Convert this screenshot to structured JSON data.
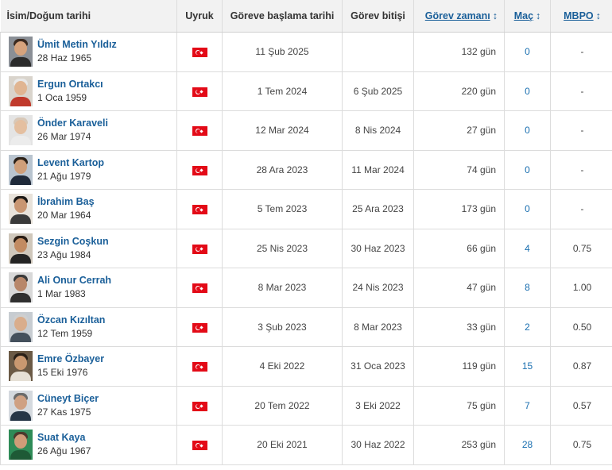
{
  "table": {
    "headers": {
      "name": "İsim/Doğum tarihi",
      "nationality": "Uyruk",
      "start": "Göreve başlama tarihi",
      "end": "Görev bitişi",
      "duration": "Görev zamanı",
      "matches": "Maç",
      "mbpo": "MBPO"
    },
    "sort_icon": "sort-icon",
    "flag_icon": "turkey-flag-icon",
    "rows": [
      {
        "name": "Ümit Metin Yıldız",
        "dob": "28 Haz 1965",
        "start": "11 Şub 2025",
        "end": "",
        "duration": "132 gün",
        "matches": "0",
        "mbpo": "-",
        "avatar": {
          "bg": "#8a8f96",
          "hair": "#3b2a20",
          "body": "#2b2b2b",
          "skin": "#d6a37d"
        }
      },
      {
        "name": "Ergun Ortakcı",
        "dob": "1 Oca 1959",
        "start": "1 Tem 2024",
        "end": "6 Şub 2025",
        "duration": "220 gün",
        "matches": "0",
        "mbpo": "-",
        "avatar": {
          "bg": "#d9d4cc",
          "hair": "#e8e8e8",
          "body": "#c0392b",
          "skin": "#e0b592"
        }
      },
      {
        "name": "Önder Karaveli",
        "dob": "26 Mar 1974",
        "start": "12 Mar 2024",
        "end": "8 Nis 2024",
        "duration": "27 gün",
        "matches": "0",
        "mbpo": "-",
        "avatar": {
          "bg": "#e4e4e4",
          "hair": "#d8c8b8",
          "body": "#ececec",
          "skin": "#e4bfa0"
        }
      },
      {
        "name": "Levent Kartop",
        "dob": "21 Ağu 1979",
        "start": "28 Ara 2023",
        "end": "11 Mar 2024",
        "duration": "74 gün",
        "matches": "0",
        "mbpo": "-",
        "avatar": {
          "bg": "#b9c4cf",
          "hair": "#2c2118",
          "body": "#1f2a3a",
          "skin": "#cf9f7a"
        }
      },
      {
        "name": "İbrahim Baş",
        "dob": "20 Mar 1964",
        "start": "5 Tem 2023",
        "end": "25 Ara 2023",
        "duration": "173 gün",
        "matches": "0",
        "mbpo": "-",
        "avatar": {
          "bg": "#e8e2da",
          "hair": "#1e1a17",
          "body": "#3a3a3a",
          "skin": "#c99672"
        }
      },
      {
        "name": "Sezgin Coşkun",
        "dob": "23 Ağu 1984",
        "start": "25 Nis 2023",
        "end": "30 Haz 2023",
        "duration": "66 gün",
        "matches": "4",
        "mbpo": "0.75",
        "avatar": {
          "bg": "#cfc7bb",
          "hair": "#2a1d14",
          "body": "#242424",
          "skin": "#c28b62"
        }
      },
      {
        "name": "Ali Onur Cerrah",
        "dob": "1 Mar 1983",
        "start": "8 Mar 2023",
        "end": "24 Nis 2023",
        "duration": "47 gün",
        "matches": "8",
        "mbpo": "1.00",
        "avatar": {
          "bg": "#d8d8d8",
          "hair": "#3a3a3a",
          "body": "#2f2f2f",
          "skin": "#b8876a"
        }
      },
      {
        "name": "Özcan Kızıltan",
        "dob": "12 Tem 1959",
        "start": "3 Şub 2023",
        "end": "8 Mar 2023",
        "duration": "33 gün",
        "matches": "2",
        "mbpo": "0.50",
        "avatar": {
          "bg": "#c7ccd1",
          "hair": "#cfcfcf",
          "body": "#44505c",
          "skin": "#d9ad8c"
        }
      },
      {
        "name": "Emre Özbayer",
        "dob": "15 Eki 1976",
        "start": "4 Eki 2022",
        "end": "31 Oca 2023",
        "duration": "119 gün",
        "matches": "15",
        "mbpo": "0.87",
        "avatar": {
          "bg": "#6b5a46",
          "hair": "#2a2017",
          "body": "#e6e0d6",
          "skin": "#c99870"
        }
      },
      {
        "name": "Cüneyt Biçer",
        "dob": "27 Kas 1975",
        "start": "20 Tem 2022",
        "end": "3 Eki 2022",
        "duration": "75 gün",
        "matches": "7",
        "mbpo": "0.57",
        "avatar": {
          "bg": "#d4d9de",
          "hair": "#6b6b6b",
          "body": "#263646",
          "skin": "#cfa183"
        }
      },
      {
        "name": "Suat Kaya",
        "dob": "26 Ağu 1967",
        "start": "20 Eki 2021",
        "end": "30 Haz 2022",
        "duration": "253 gün",
        "matches": "28",
        "mbpo": "0.75",
        "avatar": {
          "bg": "#2e8b57",
          "hair": "#4a3a2c",
          "body": "#1e5a36",
          "skin": "#cf9c78"
        }
      }
    ]
  }
}
